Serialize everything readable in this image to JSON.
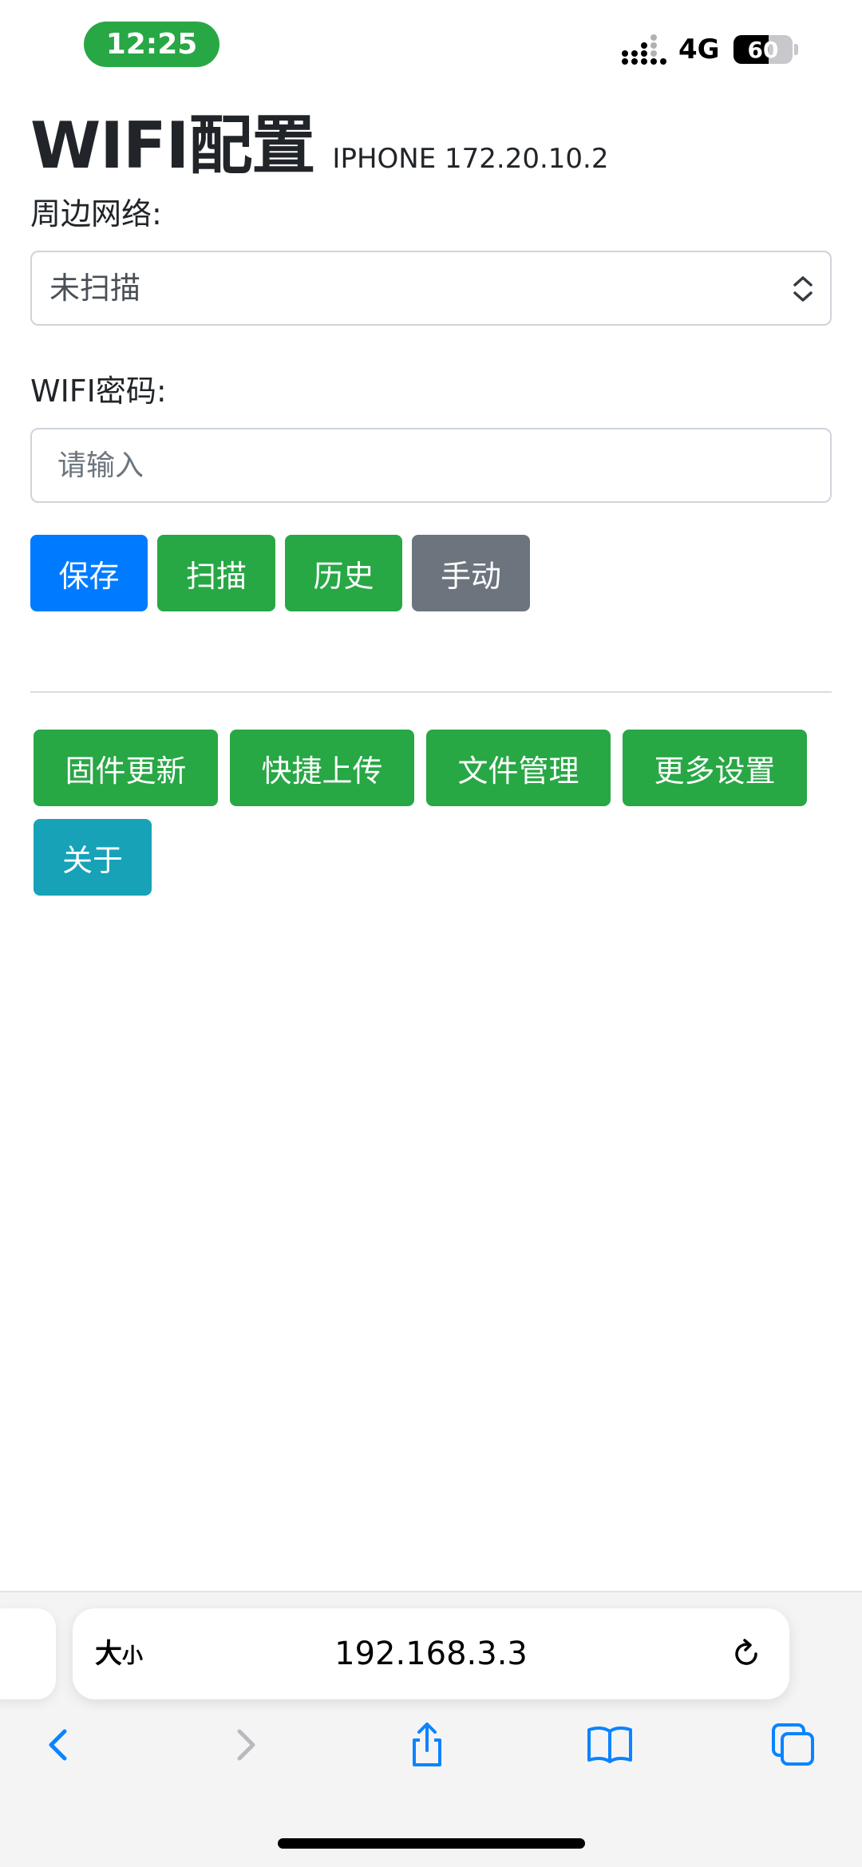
{
  "status_bar": {
    "time": "12:25",
    "network": "4G",
    "battery_level": "60",
    "battery_fraction": 0.6
  },
  "header": {
    "title": "WIFI配置",
    "subtitle": "IPHONE 172.20.10.2"
  },
  "form": {
    "networks_label": "周边网络:",
    "networks_selected": "未扫描",
    "password_label": "WIFI密码:",
    "password_placeholder": "请输入",
    "password_value": ""
  },
  "actions": {
    "save": "保存",
    "scan": "扫描",
    "history": "历史",
    "manual": "手动"
  },
  "more_actions": {
    "firmware_update": "固件更新",
    "quick_upload": "快捷上传",
    "file_manager": "文件管理",
    "more_settings": "更多设置",
    "about": "关于"
  },
  "browser": {
    "aa_large": "大",
    "aa_small": "小",
    "url": "192.168.3.3",
    "icons": [
      "back-icon",
      "forward-icon",
      "share-icon",
      "bookmarks-icon",
      "tabs-icon",
      "reload-icon"
    ]
  },
  "colors": {
    "primary": "#007bff",
    "success": "#28a745",
    "secondary": "#6c757d",
    "info": "#17a2b8",
    "ios_blue": "#0a84ff"
  }
}
